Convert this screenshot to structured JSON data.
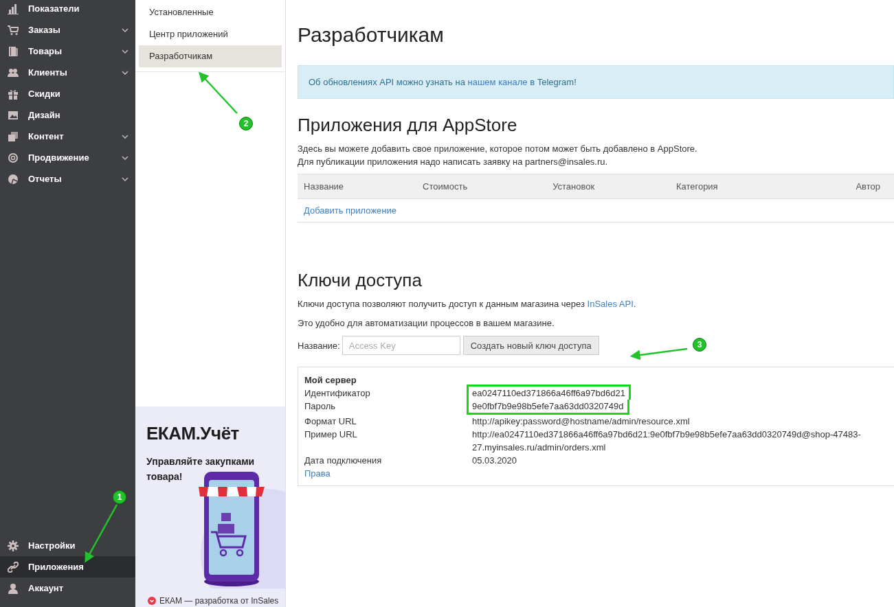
{
  "sidebar": {
    "items": [
      {
        "label": "Показатели",
        "expandable": false,
        "selected": false
      },
      {
        "label": "Заказы",
        "expandable": true,
        "selected": false
      },
      {
        "label": "Товары",
        "expandable": true,
        "selected": false
      },
      {
        "label": "Клиенты",
        "expandable": true,
        "selected": false
      },
      {
        "label": "Скидки",
        "expandable": false,
        "selected": false
      },
      {
        "label": "Дизайн",
        "expandable": false,
        "selected": false
      },
      {
        "label": "Контент",
        "expandable": true,
        "selected": false
      },
      {
        "label": "Продвижение",
        "expandable": true,
        "selected": false
      },
      {
        "label": "Отчеты",
        "expandable": true,
        "selected": false
      }
    ],
    "bottom_items": [
      {
        "label": "Настройки",
        "selected": false
      },
      {
        "label": "Приложения",
        "selected": true
      },
      {
        "label": "Аккаунт",
        "selected": false
      }
    ]
  },
  "subnav": {
    "items": [
      {
        "label": "Установленные",
        "selected": false
      },
      {
        "label": "Центр приложений",
        "selected": false
      },
      {
        "label": "Разработчикам",
        "selected": true
      }
    ]
  },
  "ad_banner": {
    "logo": "ЕКАМ.Учёт",
    "headline": "Управляйте закупками товара!",
    "footer": "ЕКАМ — разработка от InSales"
  },
  "page_title": "Разработчикам",
  "notice": {
    "before": "Об обновлениях API можно узнать на ",
    "link": "нашем канале",
    "after": " в Telegram!"
  },
  "appstore": {
    "title": "Приложения для AppStore",
    "description": [
      "Здесь вы можете добавить свое приложение, которое потом может быть добавлено в AppStore.",
      "Для публикации приложения надо написать заявку на partners@insales.ru."
    ],
    "table": {
      "columns": [
        "Название",
        "Стоимость",
        "Установок",
        "Категория",
        "Автор"
      ],
      "add_link": "Добавить приложение"
    }
  },
  "access_keys": {
    "title": "Ключи доступа",
    "intro_before": "Ключи доступа позволяют получить доступ к данным магазина через ",
    "intro_link": "InSales API",
    "intro_after": ".",
    "note": "Это удобно для автоматизации процессов в вашем магазине.",
    "form": {
      "label": "Название:",
      "placeholder": "Access Key",
      "button": "Создать новый ключ доступа"
    },
    "server": {
      "name": "Мой сервер",
      "rows": [
        {
          "label": "Идентификатор",
          "value": "ea0247110ed371866a46ff6a97bd6d21",
          "highlighted": true
        },
        {
          "label": "Пароль",
          "value": "9e0fbf7b9e98b5efe7aa63dd0320749d",
          "highlighted": true
        },
        {
          "label": "Формат URL",
          "value": "http://apikey:password@hostname/admin/resource.xml",
          "highlighted": false
        },
        {
          "label": "Пример URL",
          "value": "http://ea0247110ed371866a46ff6a97bd6d21:9e0fbf7b9e98b5efe7aa63dd0320749d@shop-47483-27.myinsales.ru/admin/orders.xml",
          "highlighted": false
        },
        {
          "label": "Дата подключения",
          "value": "05.03.2020",
          "highlighted": false
        }
      ],
      "rights_link": "Права"
    }
  },
  "annotations": [
    "1",
    "2",
    "3"
  ]
}
